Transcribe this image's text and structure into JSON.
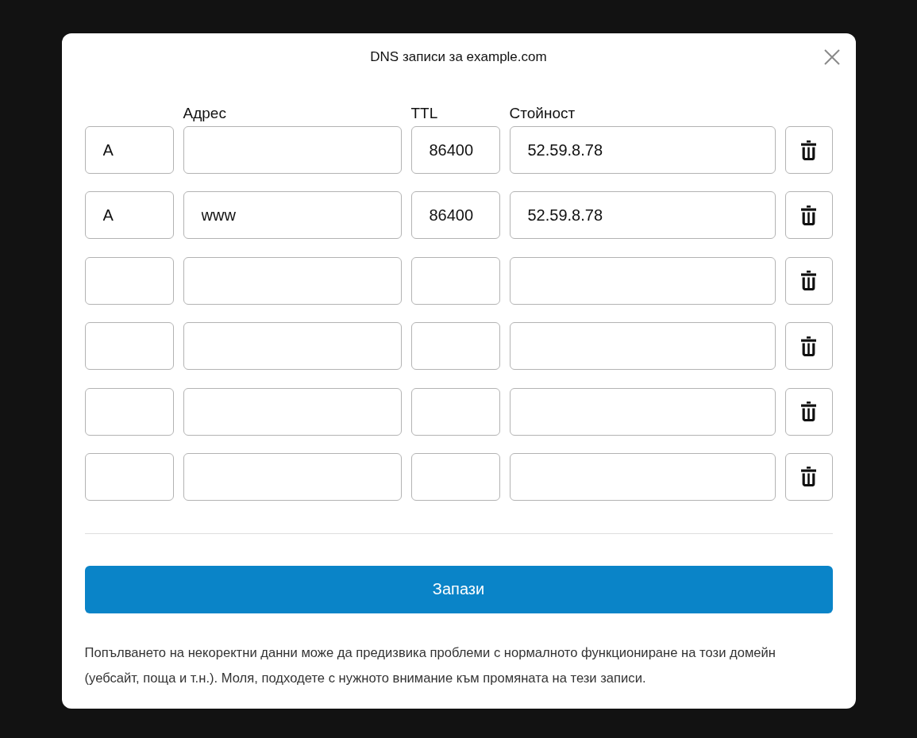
{
  "dialog": {
    "title": "DNS записи за example.com"
  },
  "table": {
    "columns": [
      "Адрес",
      "TTL",
      "Стойност"
    ],
    "rows": [
      {
        "column_1": "A",
        "ttl": "86400",
        "value": "52.59.8.78"
      },
      {
        "column_1": "A",
        "address": "www",
        "ttl": "86400",
        "value": "52.59.8.78"
      },
      {},
      {},
      {},
      {}
    ]
  },
  "save_button": {
    "label": "Запази"
  },
  "note": "Попълването на некоректни данни може да предизвика проблеми с нормалното функциониране на този домейн (уебсайт, поща и т.н.). Моля, подходете с нужното внимание към промяната на тези записи."
}
